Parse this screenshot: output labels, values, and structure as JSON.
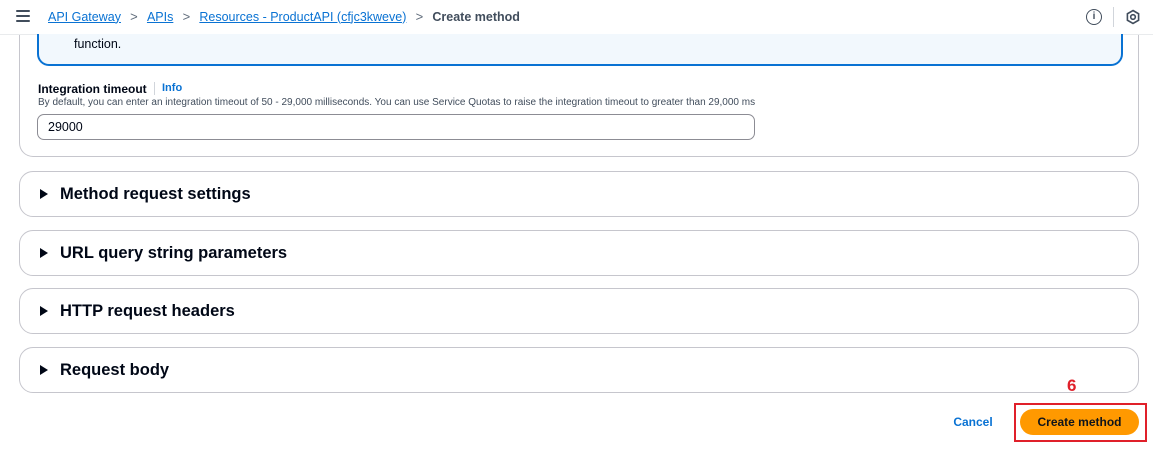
{
  "breadcrumb": {
    "items": [
      "API Gateway",
      "APIs",
      "Resources - ProductAPI (cfjc3kweve)"
    ],
    "current": "Create method",
    "separator": ">"
  },
  "toolbar": {
    "info_icon": "i",
    "icons": [
      "menu-icon",
      "info-icon",
      "settings-icon"
    ]
  },
  "integration_panel": {
    "alert_text": "function.",
    "timeout_label": "Integration timeout",
    "timeout_info": "Info",
    "timeout_description": "By default, you can enter an integration timeout of 50 - 29,000 milliseconds. You can use Service Quotas to raise the integration timeout to greater than 29,000 ms",
    "timeout_value": "29000"
  },
  "sections": [
    {
      "title": "Method request settings",
      "expanded": false
    },
    {
      "title": "URL query string parameters",
      "expanded": false
    },
    {
      "title": "HTTP request headers",
      "expanded": false
    },
    {
      "title": "Request body",
      "expanded": false
    }
  ],
  "actions": {
    "cancel_label": "Cancel",
    "create_label": "Create method"
  },
  "annotation": {
    "step_number": "6"
  },
  "colors": {
    "link": "#0972d3",
    "primary_button": "#ff9900",
    "annotation": "#e0202a",
    "alert_border": "#0972d3",
    "alert_background": "#f2f8fd"
  }
}
